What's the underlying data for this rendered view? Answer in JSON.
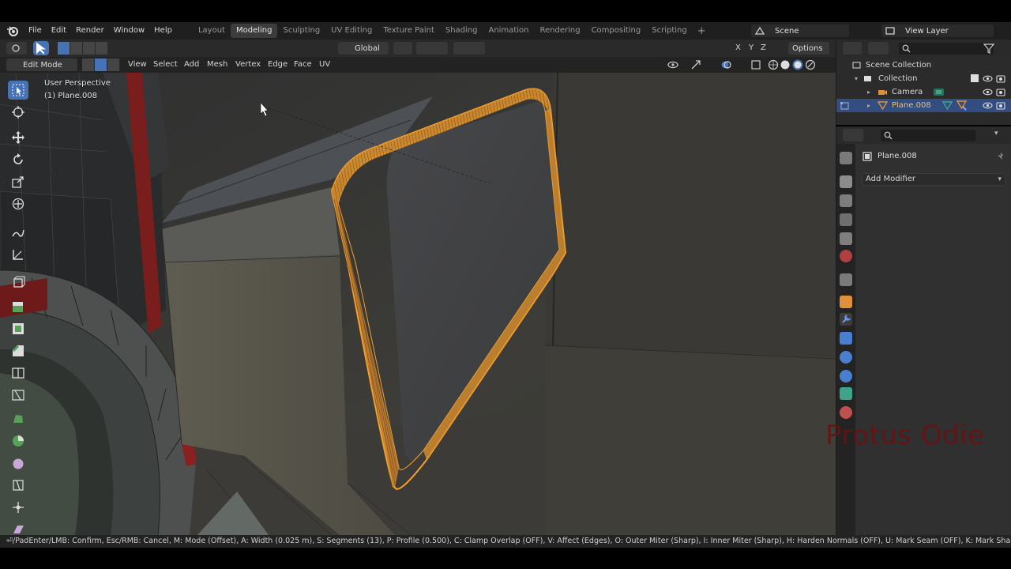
{
  "menu": {
    "items": [
      "File",
      "Edit",
      "Render",
      "Window",
      "Help"
    ],
    "workspaces": [
      "Layout",
      "Modeling",
      "Sculpting",
      "UV Editing",
      "Texture Paint",
      "Shading",
      "Animation",
      "Rendering",
      "Compositing",
      "Scripting"
    ],
    "active_workspace": "Modeling",
    "add_workspace": "+",
    "scene": "Scene",
    "view_layer": "View Layer"
  },
  "header": {
    "transform_orientation": "Global",
    "options_label": "Options",
    "axis_x": "X",
    "axis_y": "Y",
    "axis_z": "Z"
  },
  "viewport_header": {
    "mode": "Edit Mode",
    "menus": [
      "View",
      "Select",
      "Add",
      "Mesh",
      "Vertex",
      "Edge",
      "Face",
      "UV"
    ]
  },
  "viewport": {
    "perspective": "User Perspective",
    "object": "(1) Plane.008"
  },
  "outliner": {
    "scene_collection": "Scene Collection",
    "collection": "Collection",
    "items": [
      {
        "name": "Camera",
        "selected": false
      },
      {
        "name": "Plane.008",
        "selected": true
      }
    ]
  },
  "properties": {
    "object_name": "Plane.008",
    "add_modifier": "Add Modifier"
  },
  "watermark": "Protus Odie",
  "statusbar": "⏎/PadEnter/LMB: Confirm, Esc/RMB: Cancel, M: Mode (Offset), A: Width (0.025 m), S: Segments (13), P: Profile (0.500), C: Clamp Overlap (OFF), V: Affect (Edges), O: Outer Miter (Sharp), I: Inner Miter (Sharp), H: Harden Normals (OFF), U: Mark Seam (OFF), K: Mark Sharp (OFF), Z: Profile Type (Superellipse)",
  "colors": {
    "accent": "#4772b3",
    "selection_orange": "#f5a030",
    "watermark": "#6e1010"
  }
}
